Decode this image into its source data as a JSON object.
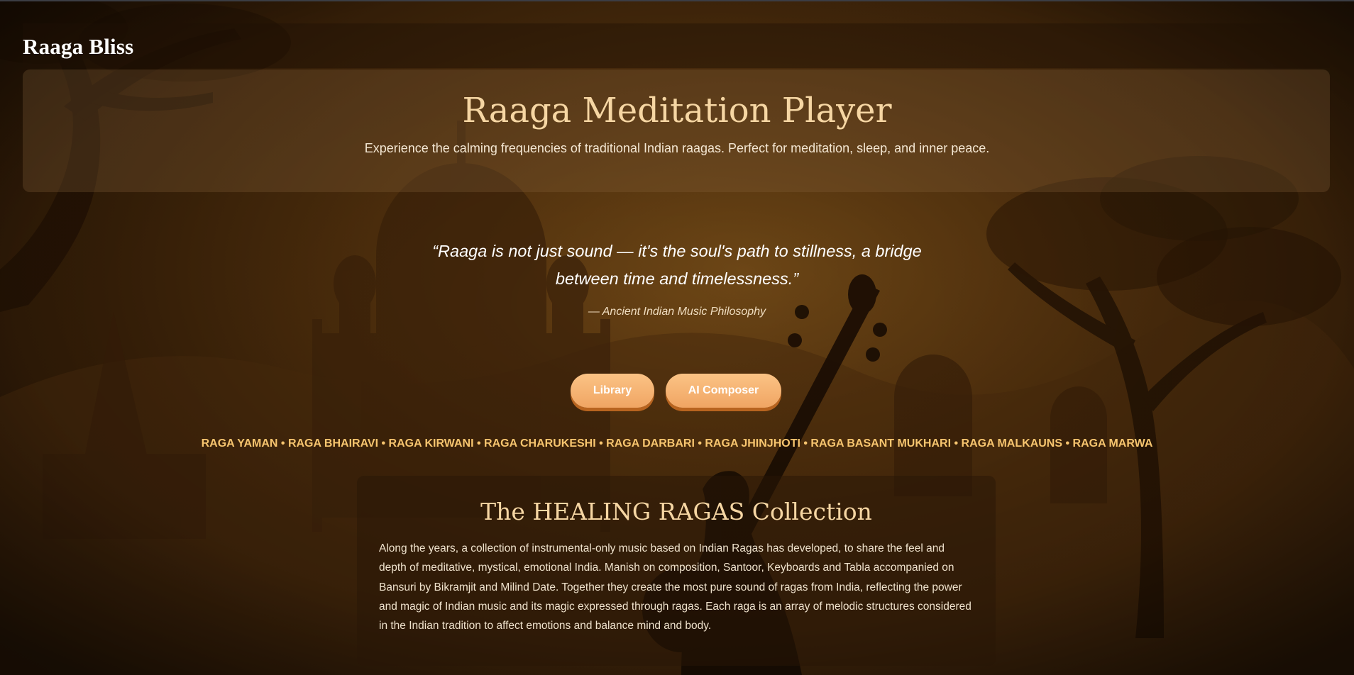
{
  "brand": {
    "name": "Raaga Bliss"
  },
  "hero": {
    "title": "Raaga Meditation Player",
    "subtitle": "Experience the calming frequencies of traditional Indian raagas. Perfect for meditation, sleep, and inner peace."
  },
  "quote": {
    "text": "“Raaga is not just sound — it's the soul's path to stillness, a bridge between time and timelessness.”",
    "attribution": "— Ancient Indian Music Philosophy"
  },
  "buttons": {
    "library_label": "Library",
    "composer_label": "AI Composer"
  },
  "raga_strip": "RAGA YAMAN • RAGA BHAIRAVI • RAGA KIRWANI • RAGA CHARUKESHI • RAGA DARBARI • RAGA JHINJHOTI • RAGA BASANT MUKHARI • RAGA MALKAUNS • RAGA MARWA",
  "collection": {
    "title": "The HEALING RAGAS Collection",
    "body": "Along the years, a collection of instrumental-only music based on Indian Ragas has developed, to share the feel and depth of meditative, mystical, emotional India. Manish on composition, Santoor, Keyboards and Tabla accompanied on Bansuri by Bikramjit and Milind Date. Together they create the most pure sound of ragas from India, reflecting the power and magic of Indian music and its magic expressed through ragas. Each raga is an array of melodic structures considered in the Indian tradition to affect emotions and balance mind and body."
  },
  "colors": {
    "accent": "#f6d6a3",
    "button": "#f0a563",
    "raga_text": "#f7c56f",
    "background": "#55330e"
  }
}
